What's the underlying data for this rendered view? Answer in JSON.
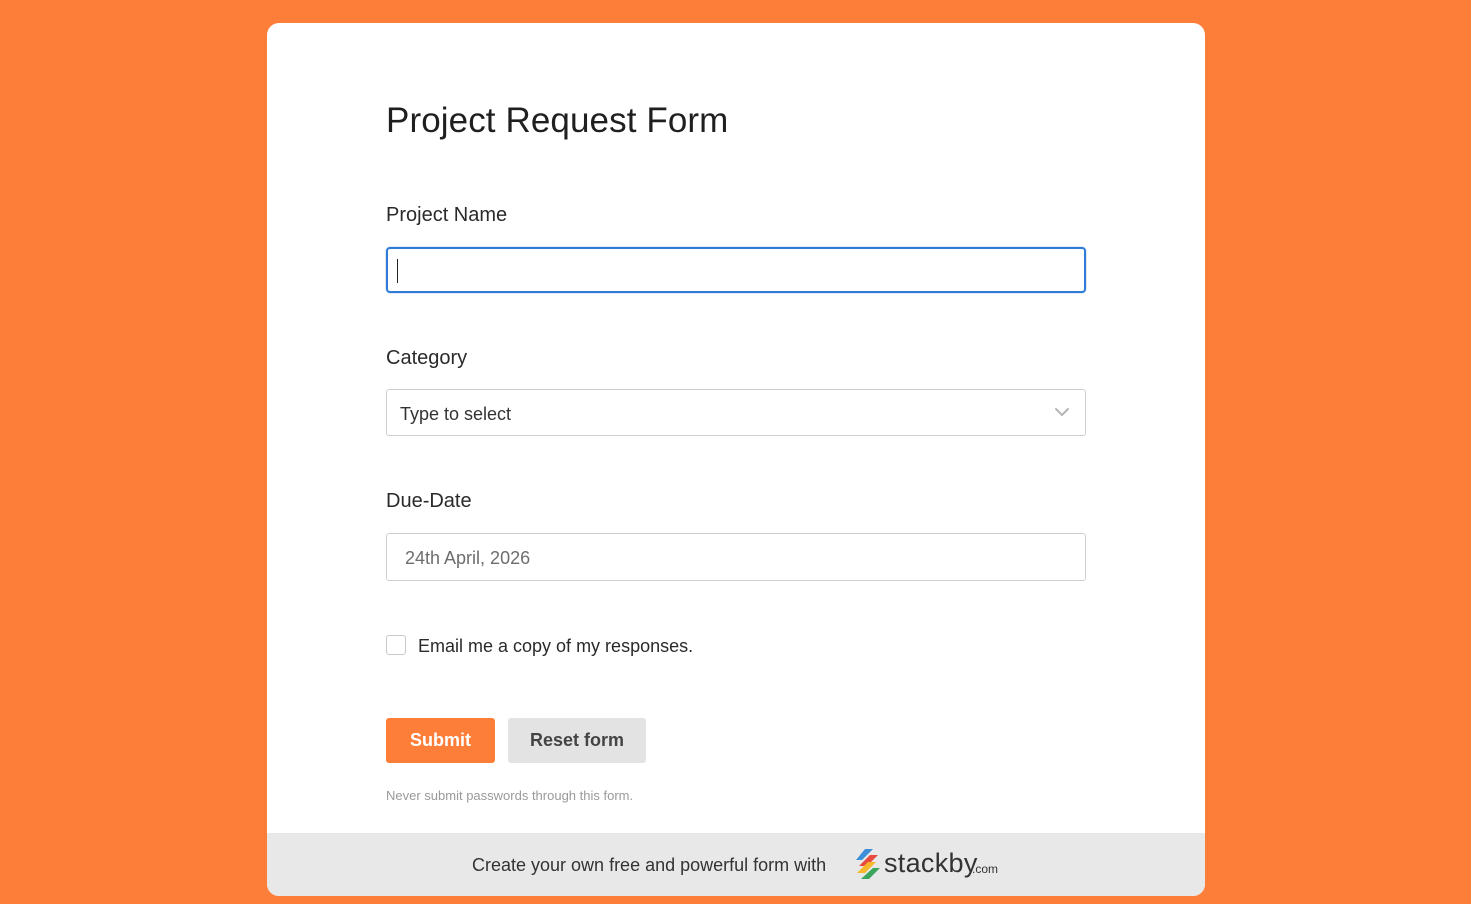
{
  "form": {
    "title": "Project Request Form",
    "fields": {
      "project_name": {
        "label": "Project Name",
        "value": ""
      },
      "category": {
        "label": "Category",
        "placeholder": "Type to select"
      },
      "due_date": {
        "label": "Due-Date",
        "value": "24th April, 2026"
      }
    },
    "email_copy": {
      "label": "Email me a copy of my responses.",
      "checked": false
    },
    "buttons": {
      "submit": "Submit",
      "reset": "Reset form"
    },
    "note": "Never submit passwords through this form."
  },
  "footer": {
    "text": "Create your own free and powerful form with",
    "logo_name": "stackby",
    "logo_suffix": ".com",
    "logo_icon": "stackby-logo-icon"
  },
  "colors": {
    "background": "#FD7E39",
    "accent": "#FD7E39",
    "focus_border": "#2f7bd8",
    "footer_bg": "#e8e8e8"
  }
}
